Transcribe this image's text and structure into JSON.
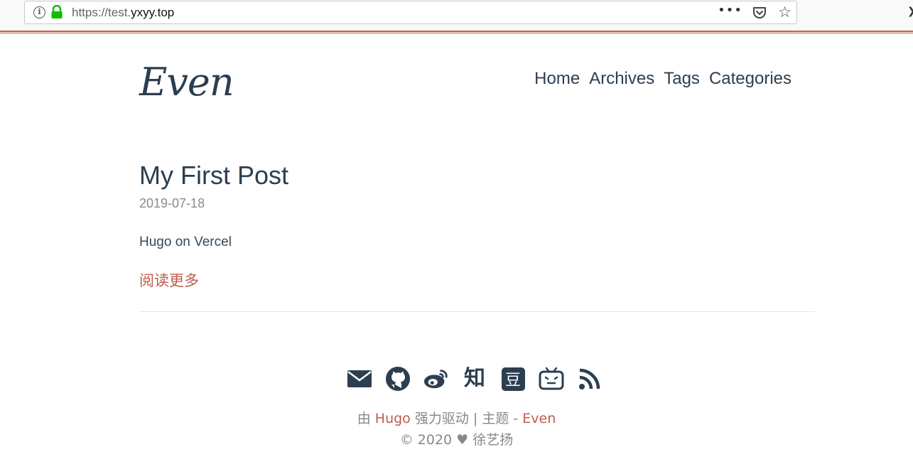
{
  "browser": {
    "url_prefix": "https://test.",
    "url_host": "yxyy.top",
    "more_glyph": "•••",
    "star_glyph": "☆",
    "chevron_glyph": "❯"
  },
  "site": {
    "logo": "Even",
    "nav": [
      "Home",
      "Archives",
      "Tags",
      "Categories"
    ]
  },
  "post": {
    "title": "My First Post",
    "date": "2019-07-18",
    "summary": "Hugo on Vercel",
    "read_more": "阅读更多"
  },
  "footer": {
    "social_icons": [
      "email-icon",
      "github-icon",
      "weibo-icon",
      "zhihu-icon",
      "douban-icon",
      "bilibili-icon",
      "rss-icon"
    ],
    "zhihu_glyph": "知",
    "douban_glyph": "豆",
    "powered_prefix": "由 ",
    "powered_hugo": "Hugo",
    "powered_middle": " 强力驱动 | 主题 - ",
    "powered_theme": "Even",
    "copyright_prefix": "© 2020 ",
    "heart_glyph": "♥",
    "author": " 徐艺扬"
  },
  "colors": {
    "accent": "#c05b4d",
    "text": "#2c3e50",
    "muted": "#8a8a8a"
  }
}
